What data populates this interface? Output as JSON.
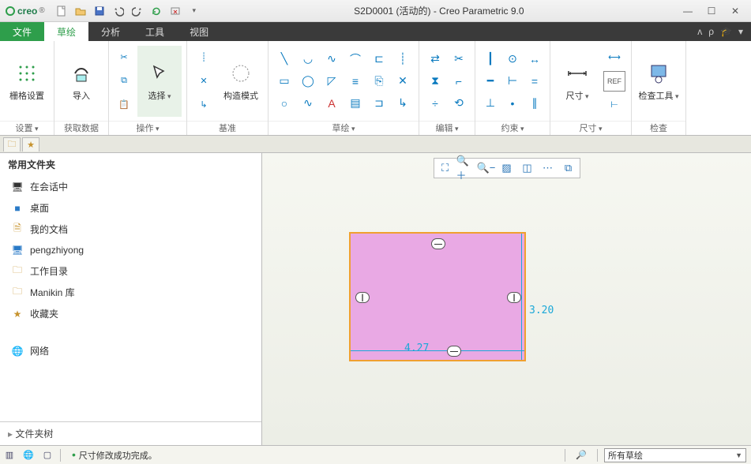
{
  "titlebar": {
    "app": "creo",
    "title": "S2D0001 (活动的) - Creo Parametric 9.0"
  },
  "tabs": {
    "file": "文件",
    "sketch": "草绘",
    "analysis": "分析",
    "tools": "工具",
    "view": "视图"
  },
  "ribbon": {
    "grid": {
      "btn": "栅格设置",
      "group": "设置"
    },
    "import": {
      "btn": "导入",
      "group": "获取数据"
    },
    "select": {
      "btn": "选择",
      "group": "操作"
    },
    "datum": {
      "construct": "构造模式",
      "group": "基准"
    },
    "sketch_group": "草绘",
    "edit_group": "编辑",
    "constrain_group": "约束",
    "dim": {
      "btn": "尺寸",
      "group": "尺寸"
    },
    "check": {
      "btn": "检查工具",
      "group": "检查"
    }
  },
  "navigator": {
    "section": "常用文件夹",
    "items": [
      "在会话中",
      "桌面",
      "我的文档",
      "pengzhiyong",
      "工作目录",
      "Manikin 库",
      "收藏夹"
    ],
    "network": "网络",
    "tree": "文件夹树"
  },
  "sketch": {
    "width": "4.27",
    "height": "3.20"
  },
  "status": {
    "message": "尺寸修改成功完成。",
    "filter": "所有草绘"
  },
  "chart_data": {
    "type": "table",
    "title": "Rectangle sketch dimensions",
    "rows": [
      {
        "dimension": "width",
        "value": 4.27
      },
      {
        "dimension": "height",
        "value": 3.2
      }
    ]
  }
}
